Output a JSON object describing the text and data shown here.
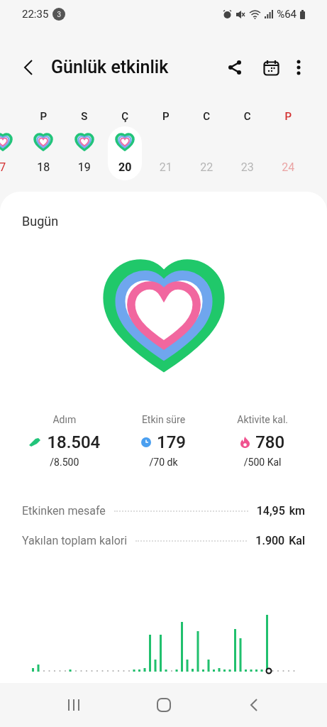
{
  "status_bar": {
    "time": "22:35",
    "notification_count": "3",
    "battery": "%64"
  },
  "header": {
    "title": "Günlük etkinlik"
  },
  "days": [
    {
      "date": "7",
      "selected": false,
      "future": false,
      "holiday": true,
      "ring": true
    },
    {
      "label": "P",
      "date": "18",
      "selected": false,
      "future": false,
      "holiday": false,
      "ring": true
    },
    {
      "label": "S",
      "date": "19",
      "selected": false,
      "future": false,
      "holiday": false,
      "ring": true
    },
    {
      "label": "Ç",
      "date": "20",
      "selected": true,
      "future": false,
      "holiday": false,
      "ring": true
    },
    {
      "label": "P",
      "date": "21",
      "selected": false,
      "future": true,
      "holiday": false,
      "ring": false
    },
    {
      "label": "C",
      "date": "22",
      "selected": false,
      "future": true,
      "holiday": false,
      "ring": false
    },
    {
      "label": "C",
      "date": "23",
      "selected": false,
      "future": true,
      "holiday": false,
      "ring": false
    },
    {
      "label": "P",
      "date": "24",
      "selected": false,
      "future": true,
      "holiday": true,
      "ring": false
    }
  ],
  "card": {
    "title": "Bugün",
    "stats": [
      {
        "kind": "steps",
        "label": "Adım",
        "value": "18.504",
        "goal": "/8.500"
      },
      {
        "kind": "time",
        "label": "Etkin süre",
        "value": "179",
        "goal": "/70 dk"
      },
      {
        "kind": "calories",
        "label": "Aktivite kal.",
        "value": "780",
        "goal": "/500 Kal"
      }
    ],
    "rows": [
      {
        "label": "Etkinken mesafe",
        "value": "14,95",
        "unit": "km"
      },
      {
        "label": "Yakılan toplam kalori",
        "value": "1.900",
        "unit": "Kal"
      }
    ]
  }
}
